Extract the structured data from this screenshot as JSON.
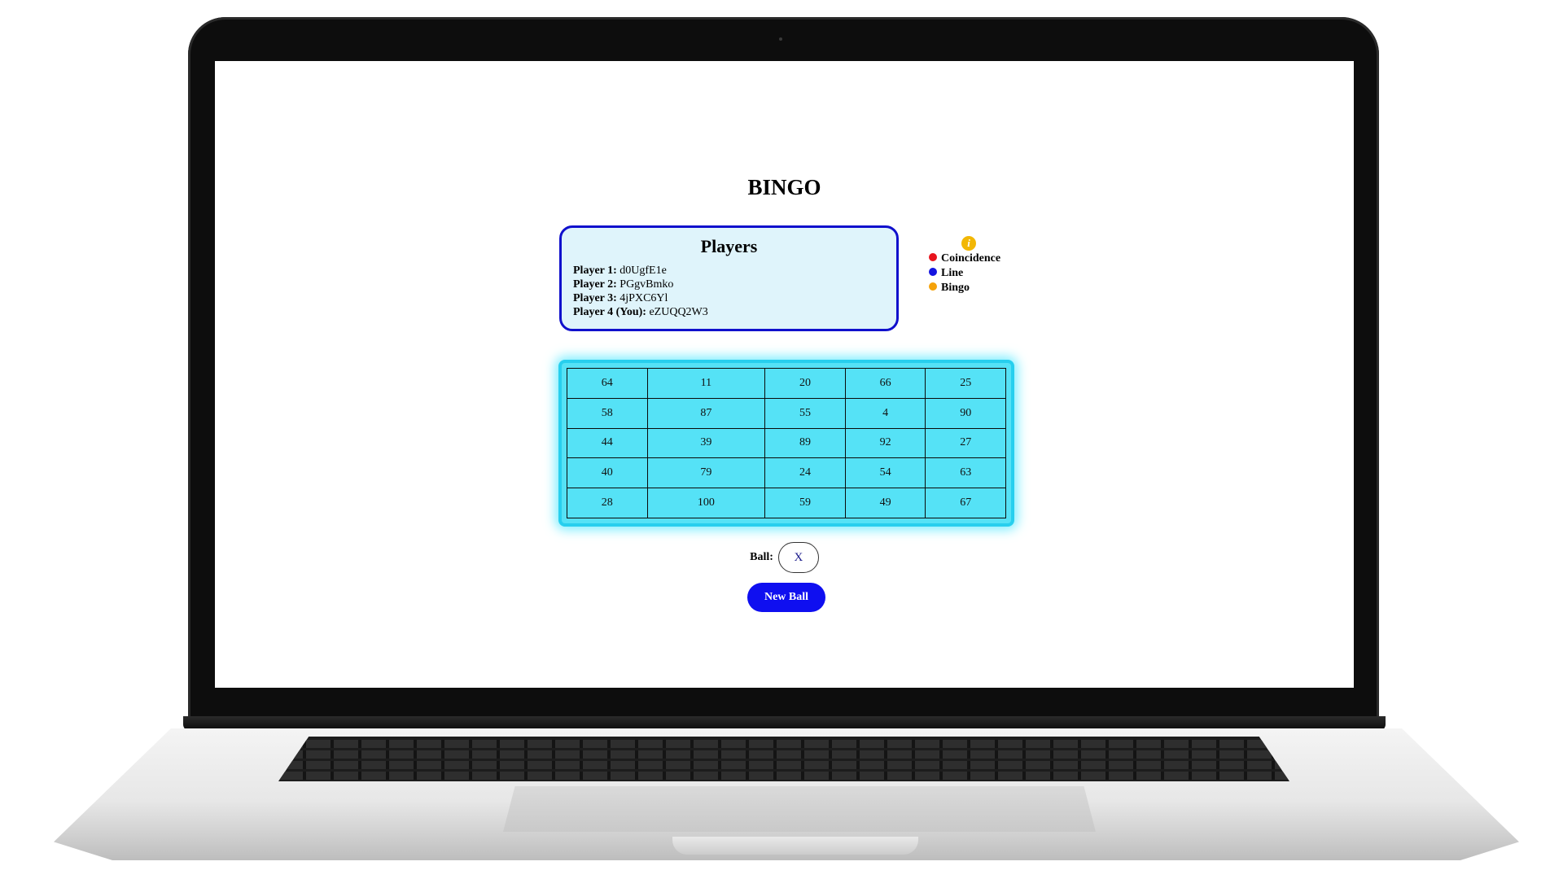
{
  "app": {
    "title": "BINGO"
  },
  "players": {
    "heading": "Players",
    "list": [
      {
        "label": "Player 1:",
        "name": "d0UgfE1e"
      },
      {
        "label": "Player 2:",
        "name": "PGgvBmko"
      },
      {
        "label": "Player 3:",
        "name": "4jPXC6Yl"
      },
      {
        "label": "Player 4 (You):",
        "name": "eZUQQ2W3"
      }
    ]
  },
  "legend": {
    "info_icon": "info-icon",
    "items": [
      {
        "label": "Coincidence",
        "color": "#e8141e"
      },
      {
        "label": "Line",
        "color": "#1414e0"
      },
      {
        "label": "Bingo",
        "color": "#f5a20a"
      }
    ]
  },
  "card": {
    "rows": [
      [
        "64",
        "11",
        "20",
        "66",
        "25"
      ],
      [
        "58",
        "87",
        "55",
        "4",
        "90"
      ],
      [
        "44",
        "39",
        "89",
        "92",
        "27"
      ],
      [
        "40",
        "79",
        "24",
        "54",
        "63"
      ],
      [
        "28",
        "100",
        "59",
        "49",
        "67"
      ]
    ]
  },
  "ball": {
    "label": "Ball:",
    "value": "X"
  },
  "controls": {
    "new_ball_label": "New Ball"
  },
  "colors": {
    "card_fill": "#55e2f6",
    "players_fill": "#dff4fb",
    "players_border": "#1010cc",
    "button": "#0f0ff0"
  }
}
